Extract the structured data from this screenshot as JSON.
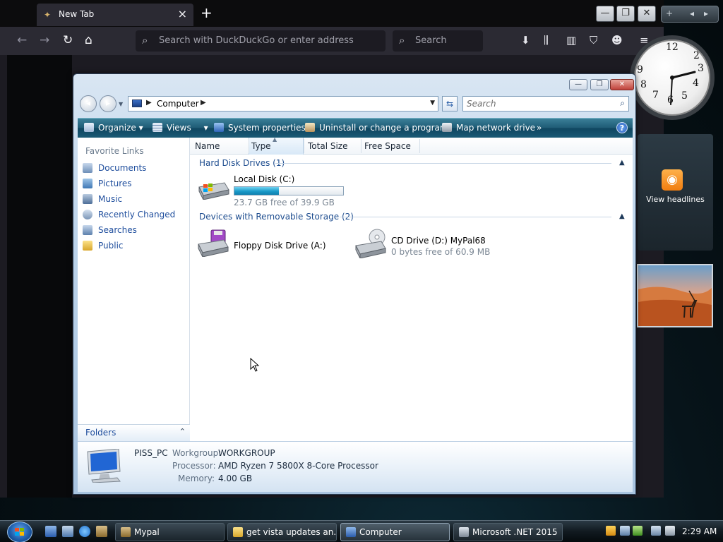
{
  "browser": {
    "tab_title": "New Tab",
    "urlbar_placeholder": "Search with DuckDuckGo or enter address",
    "search_placeholder": "Search"
  },
  "sidebar_gadgets": {
    "headlines_label": "View headlines"
  },
  "explorer": {
    "address_path": "Computer",
    "search_placeholder": "Search",
    "commands": [
      "Organize",
      "Views",
      "System properties",
      "Uninstall or change a program",
      "Map network drive"
    ],
    "more_symbol": "»",
    "nav": {
      "header": "Favorite Links",
      "links": [
        "Documents",
        "Pictures",
        "Music",
        "Recently Changed",
        "Searches",
        "Public"
      ],
      "folders_label": "Folders"
    },
    "columns": [
      "Name",
      "Type",
      "Total Size",
      "Free Space"
    ],
    "groups": [
      {
        "title": "Hard Disk Drives (1)",
        "items": [
          {
            "name": "Local Disk (C:)",
            "detail": "23.7 GB free of 39.9 GB",
            "used_fraction": 0.41
          }
        ]
      },
      {
        "title": "Devices with Removable Storage (2)",
        "items": [
          {
            "name": "Floppy Disk Drive (A:)",
            "detail": ""
          },
          {
            "name": "CD Drive (D:) MyPal68",
            "detail": "0 bytes free of 60.9 MB"
          }
        ]
      }
    ],
    "details": {
      "computer_name": "PISS_PC",
      "workgroup_label": "Workgroup:",
      "workgroup": "WORKGROUP",
      "processor_label": "Processor:",
      "processor": "AMD Ryzen 7 5800X 8-Core Processor",
      "memory_label": "Memory:",
      "memory": "4.00 GB"
    }
  },
  "taskbar": {
    "buttons": [
      "Mypal",
      "get vista updates an...",
      "Computer",
      "Microsoft .NET 2015"
    ],
    "clock": "2:29 AM"
  },
  "colors": {
    "command_bar": "#1e5a74",
    "link_blue": "#1f4e9d",
    "progress_fill": "#1a9ac8"
  }
}
